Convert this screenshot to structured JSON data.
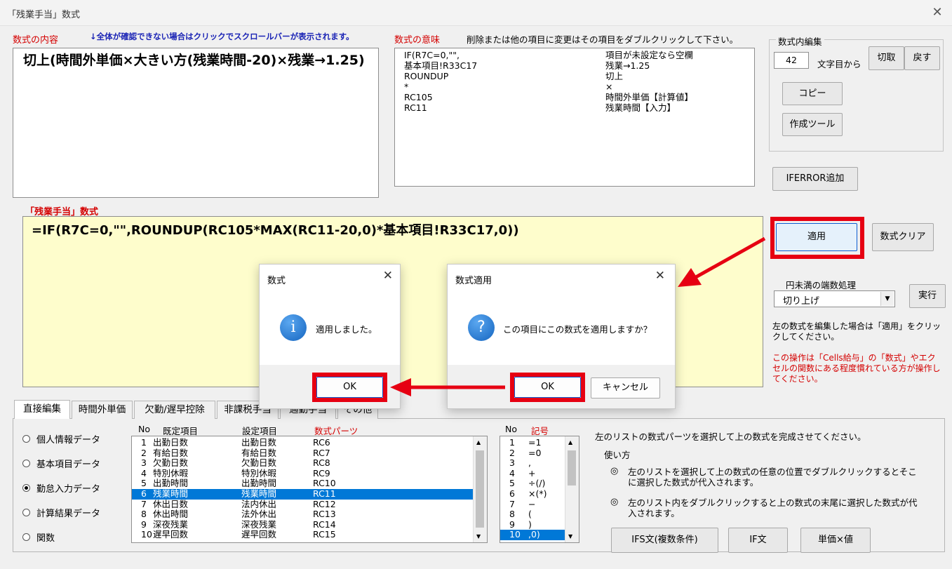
{
  "window": {
    "title": "「残業手当」数式",
    "close": "✕"
  },
  "formula_content": {
    "label": "数式の内容",
    "hint": "↓全体が確認できない場合はクリックでスクロールバーが表示されます。",
    "text": "切上(時間外単価×大きい方(残業時間-20)×残業→1.25)"
  },
  "formula_meaning": {
    "label": "数式の意味",
    "hint": "削除または他の項目に変更はその項目をダブルクリックして下さい。",
    "rows": [
      {
        "code": "IF(R7C=0,\"\",",
        "desc": "項目が未設定なら空欄"
      },
      {
        "code": "基本項目!R33C17",
        "desc": "残業→1.25"
      },
      {
        "code": "ROUNDUP",
        "desc": "切上"
      },
      {
        "code": "*",
        "desc": "×"
      },
      {
        "code": "RC105",
        "desc": "時間外単価【計算値】"
      },
      {
        "code": "RC11",
        "desc": "残業時間【入力】"
      }
    ]
  },
  "edit_group": {
    "label": "数式内編集",
    "position_value": "42",
    "position_suffix": "文字目から",
    "cut": "切取",
    "undo": "戻す",
    "copy": "コピー",
    "tool": "作成ツール"
  },
  "iferror_button": "IFERROR追加",
  "formula_editor": {
    "label": "「残業手当」数式",
    "text": "=IF(R7C=0,\"\",ROUNDUP(RC105*MAX(RC11-20,0)*基本項目!R33C17,0))"
  },
  "apply_button": "適用",
  "clear_button": "数式クリア",
  "rounding": {
    "label": "円未満の端数処理",
    "value": "切り上げ",
    "run": "実行"
  },
  "side_note": "左の数式を編集した場合は「適用」をクリックしてください。",
  "warning": "この操作は「Cells給与」の「数式」やエクセルの関数にある程度慣れている方が操作してください。",
  "dialog_done": {
    "title": "数式",
    "message": "適用しました。",
    "ok": "OK",
    "icon": "i"
  },
  "dialog_confirm": {
    "title": "数式適用",
    "message": "この項目にこの数式を適用しますか？",
    "ok": "OK",
    "cancel": "キャンセル",
    "icon": "?"
  },
  "tabs": [
    "直接編集",
    "時間外単価",
    "欠勤/遅早控除",
    "非課税手当",
    "通勤手当",
    "その他"
  ],
  "radios": [
    "個人情報データ",
    "基本項目データ",
    "勤怠入力データ",
    "計算結果データ",
    "関数"
  ],
  "parts_list": {
    "headers": {
      "no": "No",
      "default": "既定項目",
      "setting": "設定項目",
      "parts": "数式パーツ"
    },
    "rows": [
      {
        "no": "1",
        "default": "出勤日数",
        "setting": "出勤日数",
        "part": "RC6"
      },
      {
        "no": "2",
        "default": "有給日数",
        "setting": "有給日数",
        "part": "RC7"
      },
      {
        "no": "3",
        "default": "欠勤日数",
        "setting": "欠勤日数",
        "part": "RC8"
      },
      {
        "no": "4",
        "default": "特別休暇",
        "setting": "特別休暇",
        "part": "RC9"
      },
      {
        "no": "5",
        "default": "出勤時間",
        "setting": "出勤時間",
        "part": "RC10"
      },
      {
        "no": "6",
        "default": "残業時間",
        "setting": "残業時間",
        "part": "RC11"
      },
      {
        "no": "7",
        "default": "休出日数",
        "setting": "法内休出",
        "part": "RC12"
      },
      {
        "no": "8",
        "default": "休出時間",
        "setting": "法外休出",
        "part": "RC13"
      },
      {
        "no": "9",
        "default": "深夜残業",
        "setting": "深夜残業",
        "part": "RC14"
      },
      {
        "no": "10",
        "default": "遅早回数",
        "setting": "遅早回数",
        "part": "RC15"
      }
    ]
  },
  "symbol_list": {
    "headers": {
      "no": "No",
      "symbol": "記号"
    },
    "rows": [
      {
        "no": "1",
        "sym": "=1"
      },
      {
        "no": "2",
        "sym": "=0"
      },
      {
        "no": "3",
        "sym": ","
      },
      {
        "no": "4",
        "sym": "+"
      },
      {
        "no": "5",
        "sym": "÷(/)"
      },
      {
        "no": "6",
        "sym": "×(*)"
      },
      {
        "no": "7",
        "sym": "−"
      },
      {
        "no": "8",
        "sym": "("
      },
      {
        "no": "9",
        "sym": ")"
      },
      {
        "no": "10",
        "sym": ",0)"
      }
    ]
  },
  "help": {
    "intro": "左のリストの数式パーツを選択して上の数式を完成させてください。",
    "usage": "使い方",
    "item1": "左のリストを選択して上の数式の任意の位置でダブルクリックするとそこに選択した数式が代入されます。",
    "item2": "左のリスト内をダブルクリックすると上の数式の末尾に選択した数式が代入されます。"
  },
  "bottom_buttons": {
    "ifs": "IFS文(複数条件)",
    "if": "IF文",
    "unit": "単価×値"
  },
  "colors": {
    "accent_red": "#e60012",
    "selection": "#0078d7",
    "editor_bg": "#fefdcc"
  }
}
